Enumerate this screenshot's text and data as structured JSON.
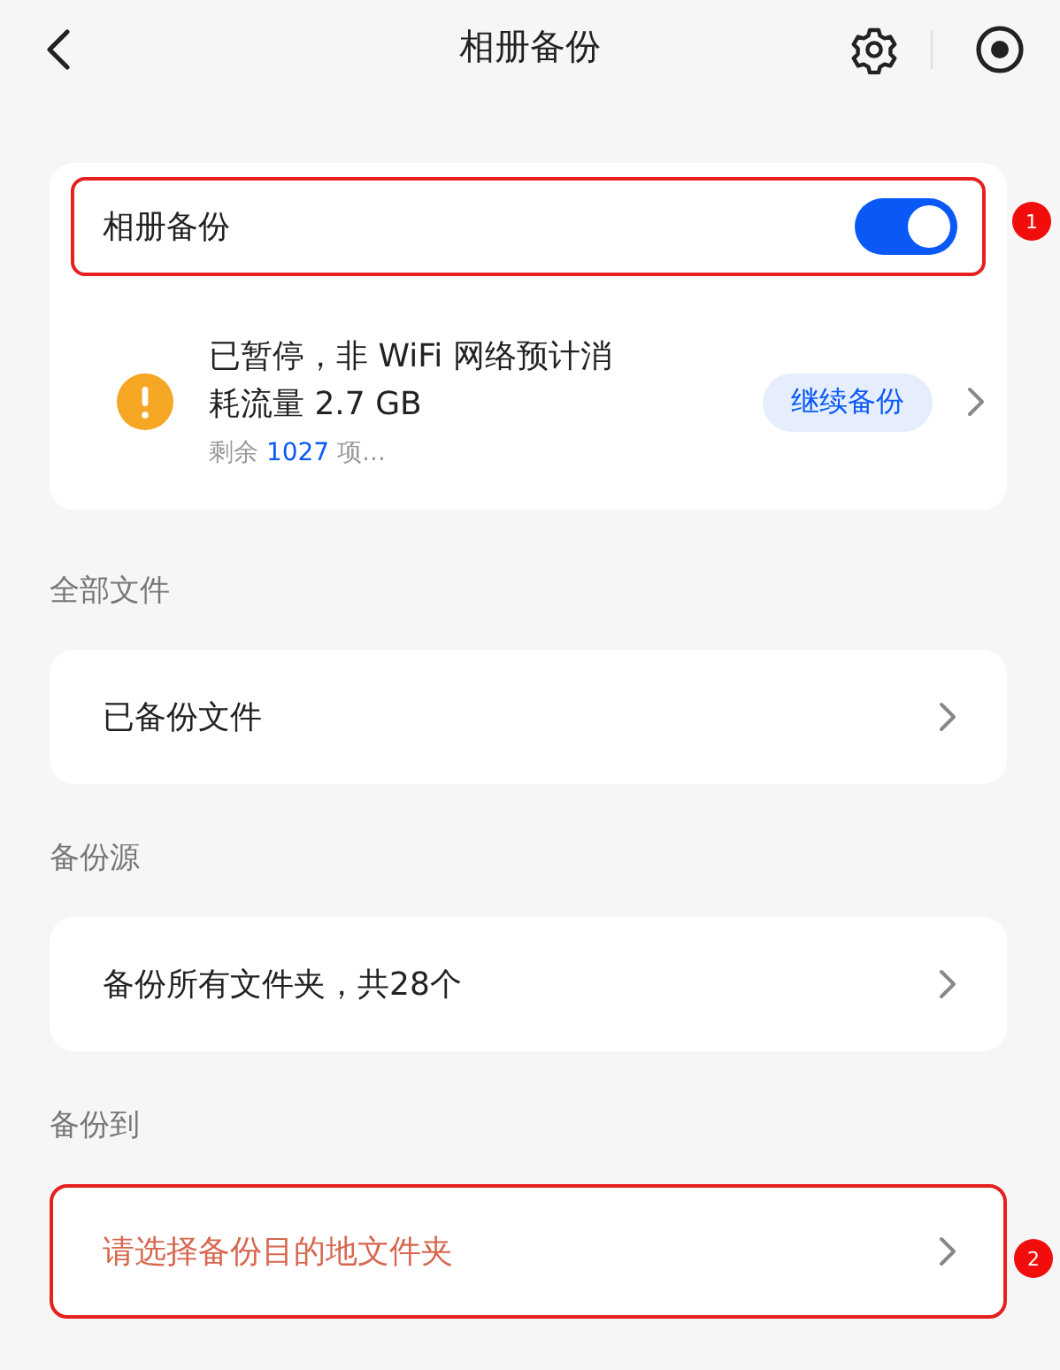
{
  "header": {
    "title": "相册备份"
  },
  "backup_card": {
    "toggle": {
      "label": "相册备份",
      "on": true,
      "annotation": "1"
    },
    "status": {
      "lines": [
        "已暂停，非 WiFi 网络预计消",
        "耗流量 2.7 GB"
      ],
      "remaining_label": "剩余",
      "remaining_count": "1027",
      "remaining_suffix": "项...",
      "action": "继续备份"
    }
  },
  "sections": [
    {
      "heading": "全部文件",
      "item": {
        "label": "已备份文件",
        "alert": false
      }
    },
    {
      "heading": "备份源",
      "item": {
        "label": "备份所有文件夹，共28个",
        "alert": false
      }
    },
    {
      "heading": "备份到",
      "item": {
        "label": "请选择备份目的地文件夹",
        "alert": true,
        "annotation": "2"
      }
    }
  ]
}
